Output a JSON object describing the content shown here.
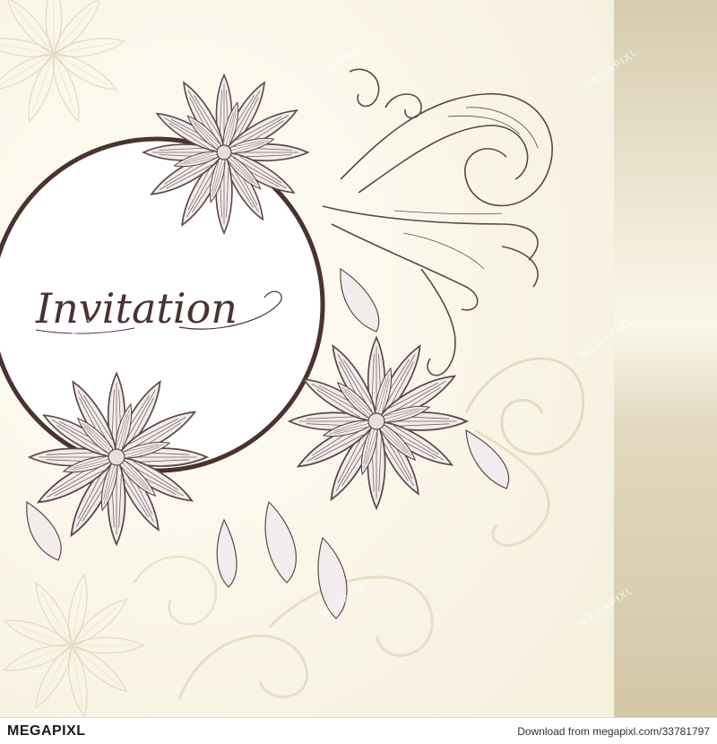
{
  "card": {
    "title": "Invitation",
    "colors": {
      "background": "#fbf8ef",
      "side_panel": "#d9cfb4",
      "ink": "#5e4848",
      "frame": "#4a3231",
      "pale_ornament": "#e6dcc2"
    }
  },
  "watermark": {
    "text": "MEGAPIXL"
  },
  "footer": {
    "logo": "MEGAPIXL",
    "credit": "Download from megapixl.com/33781797"
  }
}
